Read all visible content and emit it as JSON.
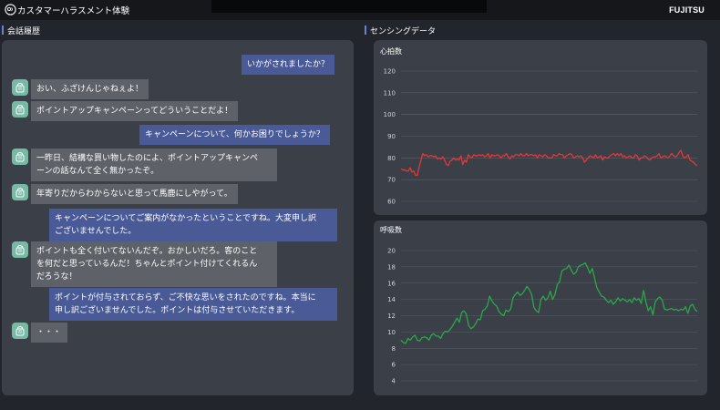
{
  "header": {
    "app_title": "カスタマーハラスメント体験",
    "brand": "FUJITSU",
    "logo_icon": "dialog-logo-icon"
  },
  "conversation": {
    "section_title": "会話履歴",
    "messages": [
      {
        "speaker": "operator",
        "text": "いかがされましたか？"
      },
      {
        "speaker": "customer",
        "text": "おい、ふざけんじゃねぇよ！"
      },
      {
        "speaker": "customer",
        "text": "ポイントアップキャンペーンってどういうことだよ！"
      },
      {
        "speaker": "operator",
        "text": "キャンペーンについて、何かお困りでしょうか？"
      },
      {
        "speaker": "customer",
        "lines": [
          "一昨日、結構な買い物したのによ、ポイントアップキャンペ",
          "ーンの話なんて全く無かったぞ。"
        ]
      },
      {
        "speaker": "customer",
        "text": "年寄りだからわからないと思って馬鹿にしやがって。"
      },
      {
        "speaker": "operator",
        "lines": [
          "キャンペーンについてご案内がなかったということですね。大変申し訳",
          "ございませんでした。"
        ]
      },
      {
        "speaker": "customer",
        "lines": [
          "ポイントも全く付いてないんだぞ。おかしいだろ。客のこと",
          "を何だと思っているんだ！ちゃんとポイント付けてくれるん",
          "だろうな！"
        ]
      },
      {
        "speaker": "operator",
        "lines": [
          "ポイントが付与されておらず、ご不快な思いをされたのですね。本当に",
          "申し訳ございませんでした。ポイントは付与させていただきます。"
        ]
      },
      {
        "speaker": "customer",
        "text": "・・・"
      }
    ],
    "avatar_icon": "customer-avatar-icon",
    "colors": {
      "operator_bubble": "#495a97",
      "customer_bubble": "#5e6168",
      "avatar": "#76b9a5"
    }
  },
  "sensing": {
    "section_title": "センシングデータ",
    "charts": [
      {
        "chart_data": {
          "type": "line",
          "title": "心拍数",
          "yticks": [
            120,
            110,
            100,
            90,
            80,
            70,
            60
          ],
          "ylim": [
            60,
            120
          ],
          "grid": true,
          "series": [
            {
              "color": "#e0393c",
              "values": [
                75,
                74.5,
                74.5,
                74,
                74,
                75.5,
                73.5,
                74,
                72,
                72,
                76,
                79,
                82,
                81,
                81.5,
                80.5,
                81,
                81,
                80.5,
                81,
                79.5,
                80,
                79.5,
                80.5,
                79,
                77,
                76.5,
                78.5,
                79,
                80,
                79,
                79.5,
                79,
                81,
                77,
                79,
                78,
                81.5,
                80.5,
                80,
                81.5,
                81,
                81,
                81.5,
                81,
                81.5,
                80.5,
                81,
                82,
                80,
                81.5,
                81,
                81,
                81.5,
                81,
                80,
                81,
                81,
                82,
                80.5,
                79.5,
                81,
                80.5,
                81.5,
                81.5,
                81,
                82,
                81,
                81,
                82,
                81,
                81.5,
                81.5,
                81,
                81.5,
                80,
                81.5,
                81,
                80.5,
                81.5,
                81,
                80,
                80,
                80,
                81.5,
                81,
                81,
                82,
                81.5,
                81.5,
                80,
                81,
                81.5,
                82,
                81.5,
                80,
                80.5,
                81,
                80.5,
                81,
                80,
                78,
                79,
                80,
                81,
                80.5,
                80,
                81.5,
                80,
                80.5,
                81,
                79,
                80.5,
                80,
                80,
                81,
                81.5,
                82,
                81,
                82,
                81,
                82,
                80.5,
                81,
                80,
                80.5,
                81,
                80,
                80,
                81.5,
                81,
                79,
                80,
                80,
                81,
                80.5,
                79.5,
                79,
                80,
                80.5,
                80.5,
                81,
                82,
                80,
                80.5,
                81,
                80.5,
                80,
                81,
                82,
                81,
                80.5,
                81,
                82.5,
                83.5,
                81,
                80,
                80.5,
                81.5,
                79,
                78.5,
                78,
                77,
                76.5
              ]
            }
          ]
        }
      },
      {
        "chart_data": {
          "type": "line",
          "title": "呼吸数",
          "yticks": [
            20,
            18,
            16,
            14,
            12,
            10,
            8,
            6,
            4
          ],
          "ylim": [
            4,
            20
          ],
          "grid": true,
          "series": [
            {
              "color": "#2aa84a",
              "values": [
                9.0,
                8.7,
                8.6,
                9.2,
                9.0,
                9.4,
                9.6,
                9.0,
                8.9,
                9.3,
                9.4,
                9.3,
                9.0,
                9.6,
                9.8,
                9.5,
                9.5,
                9.2,
                9.8,
                10.1,
                10.0,
                10.3,
                10.7,
                11.2,
                11.7,
                11.2,
                12.4,
                12.6,
                12.2,
                10.8,
                10.4,
                10.6,
                11.0,
                11.6,
                11.5,
                12.6,
                12.8,
                13.2,
                14.4,
                13.8,
                13.4,
                13.2,
                12.5,
                12.2,
                12.0,
                12.7,
                12.5,
                12.8,
                14.2,
                14.6,
                14.9,
                14.5,
                14.7,
                15.1,
                15.6,
                15.2,
                14.6,
                13.0,
                12.6,
                12.4,
                14.0,
                14.4,
                13.9,
                14.2,
                15.0,
                14.0,
                14.6,
                15.8,
                16.2,
                17.5,
                17.7,
                17.8,
                18.2,
                17.6,
                17.1,
                17.3,
                18.0,
                18.2,
                18.3,
                18.5,
                17.9,
                17.2,
                17.8,
                16.6,
                15.4,
                14.9,
                14.4,
                14.3,
                13.9,
                13.6,
                13.9,
                13.4,
                13.7,
                14.2,
                13.8,
                14.1,
                13.9,
                13.7,
                14.0,
                13.6,
                14.2,
                13.9,
                14.1,
                13.5,
                15.1,
                13.7,
                12.6,
                13.1,
                12.1,
                13.7,
                14.1,
                14.3,
                13.9,
                12.8,
                12.7,
                12.8,
                12.9,
                12.7,
                12.8,
                12.6,
                12.8,
                12.7,
                13.1,
                12.3,
                13.2,
                13.4,
                12.8,
                12.5
              ]
            }
          ]
        }
      }
    ]
  }
}
